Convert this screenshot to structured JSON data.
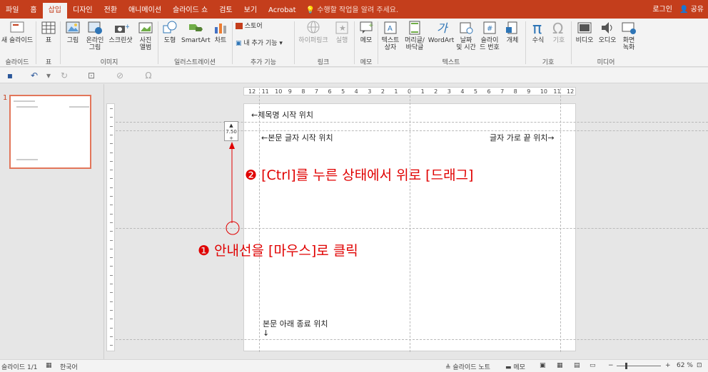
{
  "tabs": [
    "파일",
    "홈",
    "삽입",
    "디자인",
    "전환",
    "애니메이션",
    "슬라이드 쇼",
    "검토",
    "보기",
    "Acrobat"
  ],
  "active_tab": "삽입",
  "tell_me": "수행할 작업을 알려 주세요.",
  "account": {
    "login": "로그인",
    "share": "공유"
  },
  "ribbon": {
    "new_slide": "새 슬라이드",
    "table": "표",
    "picture": "그림",
    "online_picture_1": "온라인",
    "online_picture_2": "그림",
    "screenshot": "스크린샷",
    "album_1": "사진",
    "album_2": "앨범",
    "shapes": "도형",
    "smartart": "SmartArt",
    "chart": "차트",
    "store": "스토어",
    "my_addins": "내 추가 기능",
    "hyperlink": "하이퍼링크",
    "action": "실행",
    "comment": "메모",
    "textbox_1": "텍스트",
    "textbox_2": "상자",
    "header_1": "머리글/",
    "header_2": "바닥글",
    "wordart": "WordArt",
    "datetime_1": "날짜",
    "datetime_2": "및 시간",
    "slidenum_1": "슬라이",
    "slidenum_2": "드 번호",
    "object": "개체",
    "equation": "수식",
    "symbol": "기호",
    "video": "비디오",
    "audio": "오디오",
    "screenrec_1": "화면",
    "screenrec_2": "녹화",
    "groups": {
      "slides": "슬라이드",
      "tables": "표",
      "images": "이미지",
      "illustrations": "일러스트레이션",
      "addins": "추가 기능",
      "links": "링크",
      "comments": "메모",
      "text": "텍스트",
      "symbols": "기호",
      "media": "미디어"
    }
  },
  "thumb": {
    "number": "1"
  },
  "ruler_labels": [
    "12",
    "11",
    "10",
    "9",
    "8",
    "7",
    "6",
    "5",
    "4",
    "3",
    "2",
    "1",
    "0",
    "1",
    "2",
    "3",
    "4",
    "5",
    "6",
    "7",
    "8",
    "9",
    "10",
    "11",
    "12"
  ],
  "guide_tooltip": "7.50",
  "slide_text": {
    "title_start": "←제목명 시작 위치",
    "body_start": "←본문 글자 시작 위치",
    "width_end": "글자 가로 끝 위치→",
    "body_end_1": "본문 아래 종료 위치",
    "body_end_2": "↓"
  },
  "annotations": {
    "step2": "❷ [Ctrl]를 누른 상태에서 위로 [드래그]",
    "step1": "❶ 안내선을 [마우스]로 클릭"
  },
  "status": {
    "slide": "슬라이드 1/1",
    "lang": "한국어",
    "notes": "슬라이드 노트",
    "comments": "메모",
    "zoom": "62 %"
  },
  "colors": {
    "accent": "#c43e1c",
    "annotation": "#e00000"
  }
}
